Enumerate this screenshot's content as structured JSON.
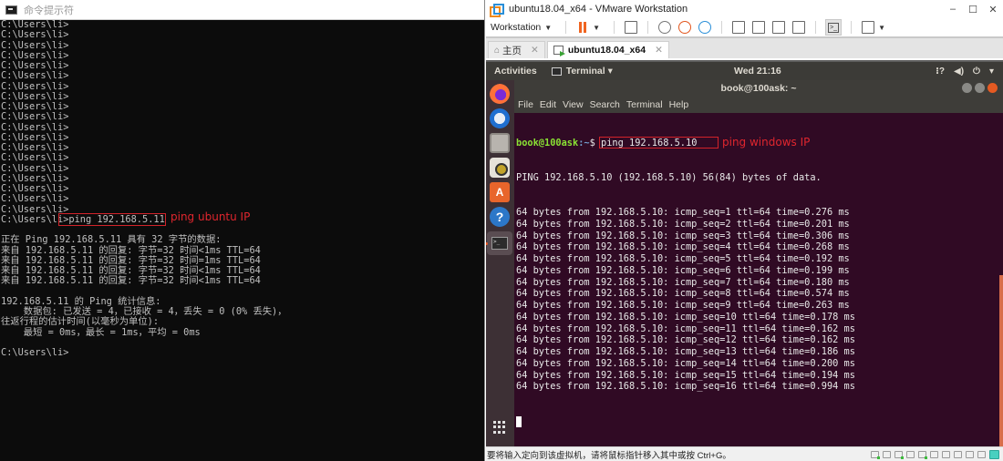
{
  "cmd_window": {
    "title": "命令提示符",
    "prompt": "C:\\Users\\li>",
    "history_prompt_count": 19,
    "command": "ping 192.168.5.11",
    "annotation": "ping ubuntu IP",
    "output_lines": [
      "",
      "正在 Ping 192.168.5.11 具有 32 字节的数据:",
      "来自 192.168.5.11 的回复: 字节=32 时间<1ms TTL=64",
      "来自 192.168.5.11 的回复: 字节=32 时间=1ms TTL=64",
      "来自 192.168.5.11 的回复: 字节=32 时间<1ms TTL=64",
      "来自 192.168.5.11 的回复: 字节=32 时间<1ms TTL=64",
      "",
      "192.168.5.11 的 Ping 统计信息:",
      "    数据包: 已发送 = 4，已接收 = 4，丢失 = 0 (0% 丢失)，",
      "往返行程的估计时间(以毫秒为单位):",
      "    最短 = 0ms，最长 = 1ms，平均 = 0ms",
      "",
      "C:\\Users\\li>"
    ]
  },
  "vmware": {
    "title": "ubuntu18.04_x64 - VMware Workstation",
    "window_controls": {
      "minimize": "–",
      "maximize": "☐",
      "close": "✕"
    },
    "toolbar": {
      "workstation_menu": "Workstation",
      "icons": [
        "pause-icon",
        "send-ctrl-alt-del-icon",
        "snapshot-icon",
        "revert-snapshot-icon",
        "snapshot-manager-icon",
        "sidebar-view-icon",
        "thumbnail-view-icon",
        "fullscreen-icon",
        "unity-icon",
        "console-view-icon",
        "stretch-icon"
      ]
    },
    "tabs": [
      {
        "label": "主页",
        "active": false
      },
      {
        "label": "ubuntu18.04_x64",
        "active": true
      }
    ],
    "status_message": "要将输入定向到该虚拟机，请将鼠标指针移入其中或按 Ctrl+G。"
  },
  "ubuntu": {
    "topbar": {
      "activities": "Activities",
      "app_menu": "Terminal ▾",
      "clock": "Wed 21:16",
      "system_icons": [
        "network-icon",
        "volume-icon",
        "power-icon",
        "chevron-down-icon"
      ]
    },
    "dock_apps": [
      "Firefox",
      "Thunderbird",
      "Files",
      "Rhythmbox",
      "Ubuntu Software",
      "Help",
      "Terminal"
    ],
    "terminal": {
      "title": "book@100ask: ~",
      "menu": [
        "File",
        "Edit",
        "View",
        "Search",
        "Terminal",
        "Help"
      ],
      "prompt_user": "book@100ask",
      "prompt_path": ":~",
      "prompt_symbol": "$",
      "command": "ping 192.168.5.10",
      "annotation": "ping windows IP",
      "header": "PING 192.168.5.10 (192.168.5.10) 56(84) bytes of data.",
      "replies": [
        "64 bytes from 192.168.5.10: icmp_seq=1 ttl=64 time=0.276 ms",
        "64 bytes from 192.168.5.10: icmp_seq=2 ttl=64 time=0.201 ms",
        "64 bytes from 192.168.5.10: icmp_seq=3 ttl=64 time=0.306 ms",
        "64 bytes from 192.168.5.10: icmp_seq=4 ttl=64 time=0.268 ms",
        "64 bytes from 192.168.5.10: icmp_seq=5 ttl=64 time=0.192 ms",
        "64 bytes from 192.168.5.10: icmp_seq=6 ttl=64 time=0.199 ms",
        "64 bytes from 192.168.5.10: icmp_seq=7 ttl=64 time=0.180 ms",
        "64 bytes from 192.168.5.10: icmp_seq=8 ttl=64 time=0.574 ms",
        "64 bytes from 192.168.5.10: icmp_seq=9 ttl=64 time=0.263 ms",
        "64 bytes from 192.168.5.10: icmp_seq=10 ttl=64 time=0.178 ms",
        "64 bytes from 192.168.5.10: icmp_seq=11 ttl=64 time=0.162 ms",
        "64 bytes from 192.168.5.10: icmp_seq=12 ttl=64 time=0.162 ms",
        "64 bytes from 192.168.5.10: icmp_seq=13 ttl=64 time=0.186 ms",
        "64 bytes from 192.168.5.10: icmp_seq=14 ttl=64 time=0.200 ms",
        "64 bytes from 192.168.5.10: icmp_seq=15 ttl=64 time=0.194 ms",
        "64 bytes from 192.168.5.10: icmp_seq=16 ttl=64 time=0.994 ms"
      ]
    }
  },
  "colors": {
    "annotation_red": "#e0262e",
    "ubuntu_bg": "#300a24",
    "prompt_green": "#8ae234",
    "prompt_blue": "#729fcf",
    "vmware_pause_orange": "#f06420"
  }
}
